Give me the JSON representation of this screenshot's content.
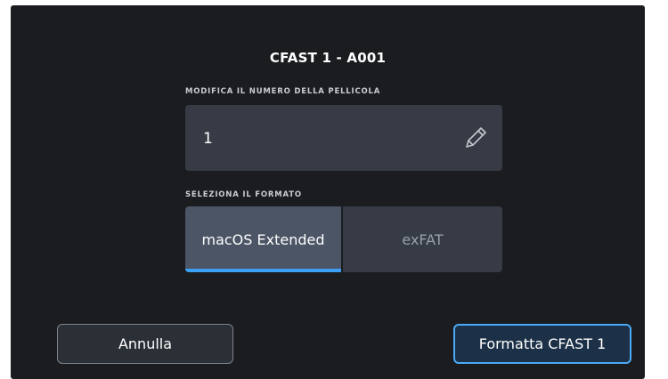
{
  "dialog": {
    "title": "CFAST 1 - A001"
  },
  "reel_section": {
    "label": "MODIFICA IL NUMERO DELLA PELLICOLA",
    "value": "1",
    "edit_icon": "pencil-icon"
  },
  "format_section": {
    "label": "SELEZIONA IL FORMATO",
    "options": [
      {
        "label": "macOS Extended",
        "selected": true
      },
      {
        "label": "exFAT",
        "selected": false
      }
    ],
    "accent_color": "#3da0f5"
  },
  "buttons": {
    "cancel_label": "Annulla",
    "format_label": "Formatta CFAST 1"
  }
}
